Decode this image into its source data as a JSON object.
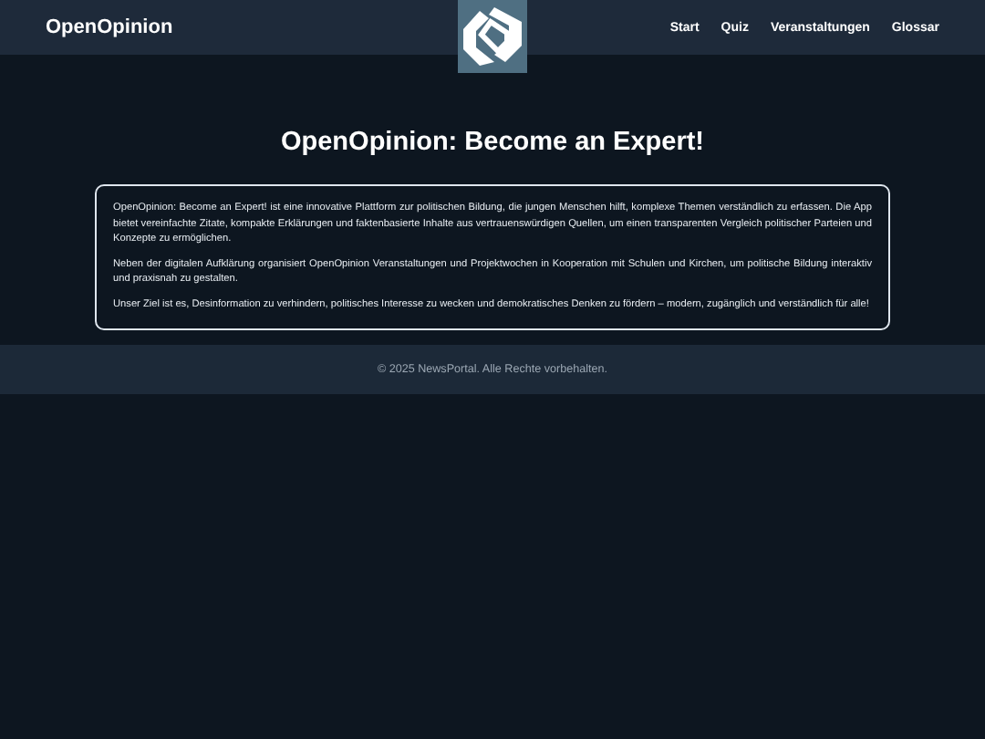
{
  "header": {
    "brand": "OpenOpinion",
    "nav": [
      {
        "label": "Start"
      },
      {
        "label": "Quiz"
      },
      {
        "label": "Veranstaltungen"
      },
      {
        "label": "Glossar"
      }
    ]
  },
  "main": {
    "title": "OpenOpinion: Become an Expert!",
    "paragraphs": [
      "OpenOpinion: Become an Expert! ist eine innovative Plattform zur politischen Bildung, die jungen Menschen hilft, komplexe Themen verständlich zu erfassen. Die App bietet vereinfachte Zitate, kompakte Erklärungen und faktenbasierte Inhalte aus vertrauenswürdigen Quellen, um einen transparenten Vergleich politischer Parteien und Konzepte zu ermöglichen.",
      "Neben der digitalen Aufklärung organisiert OpenOpinion Veranstaltungen und Projektwochen in Kooperation mit Schulen und Kirchen, um politische Bildung interaktiv und praxisnah zu gestalten.",
      "Unser Ziel ist es, Desinformation zu verhindern, politisches Interesse zu wecken und demokratisches Denken zu fördern – modern, zugänglich und verständlich für alle!"
    ]
  },
  "footer": {
    "text": "© 2025 NewsPortal. Alle Rechte vorbehalten."
  }
}
